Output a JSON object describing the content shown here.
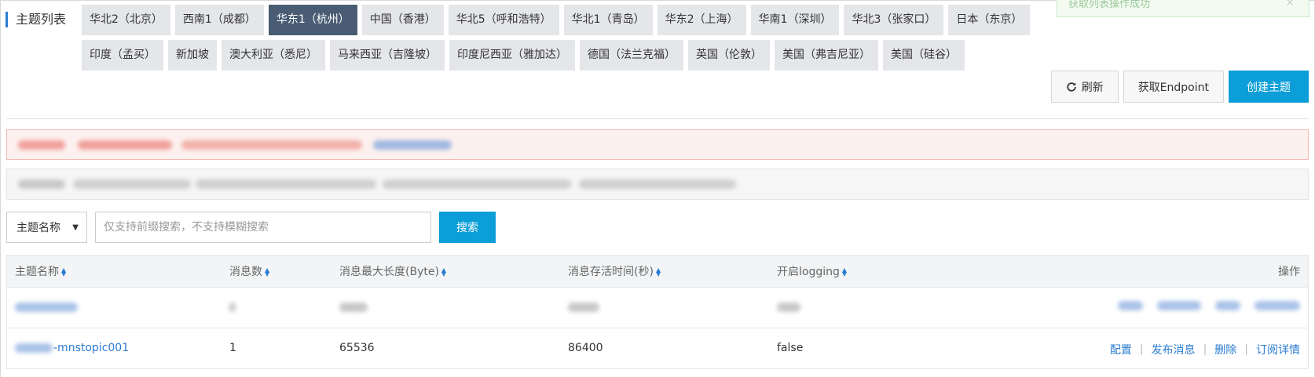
{
  "header": {
    "title": "主题列表",
    "regions_row1": [
      "华北2（北京）",
      "西南1（成都）",
      "华东1（杭州）",
      "中国（香港）",
      "华北5（呼和浩特）",
      "华北1（青岛）",
      "华东2（上海）",
      "华南1（深圳）",
      "华北3（张家口）",
      "日本（东京）"
    ],
    "regions_row2": [
      "印度（孟买）",
      "新加坡",
      "澳大利亚（悉尼）",
      "马来西亚（吉隆坡）",
      "印度尼西亚（雅加达）",
      "德国（法兰克福）",
      "英国（伦敦）",
      "美国（弗吉尼亚）",
      "美国（硅谷）"
    ],
    "active_region": "华东1（杭州）"
  },
  "toast": {
    "text": "获取列表操作成功"
  },
  "toolbar": {
    "refresh_label": "刷新",
    "endpoint_label": "获取Endpoint",
    "create_label": "创建主题"
  },
  "search": {
    "field_selected": "主题名称",
    "placeholder": "仅支持前缀搜索，不支持模糊搜索",
    "button_label": "搜索"
  },
  "table": {
    "columns": [
      "主题名称",
      "消息数",
      "消息最大长度(Byte)",
      "消息存活时间(秒)",
      "开启logging",
      "操作"
    ],
    "rows": [
      {
        "name": "-mnstopic001",
        "messages": "1",
        "max_length": "65536",
        "ttl": "86400",
        "logging": "false",
        "ops": [
          "配置",
          "发布消息",
          "删除",
          "订阅详情"
        ]
      }
    ]
  },
  "colors": {
    "accent": "#0b9ed8",
    "link": "#2b7dd1",
    "active_region": "#4a5c74",
    "region_bg": "#e4e6e9"
  }
}
